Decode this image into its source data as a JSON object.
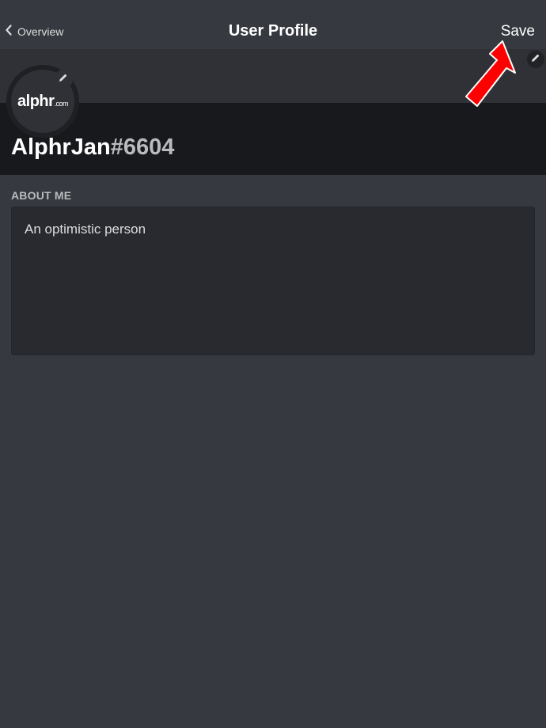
{
  "nav": {
    "back_label": "Overview",
    "title": "User Profile",
    "save_label": "Save"
  },
  "profile": {
    "avatar_logo": "alphr",
    "avatar_logo_suffix": ".com",
    "username": "AlphrJan",
    "discriminator": "#6604"
  },
  "about": {
    "label": "ABOUT ME",
    "text": "An optimistic person"
  },
  "icons": {
    "back": "chevron-left-icon",
    "edit": "pencil-icon",
    "annotation": "red-arrow"
  },
  "colors": {
    "background": "#36393f",
    "banner": "#2f3136",
    "name_block": "#18191c",
    "annotation": "#ff0000"
  }
}
